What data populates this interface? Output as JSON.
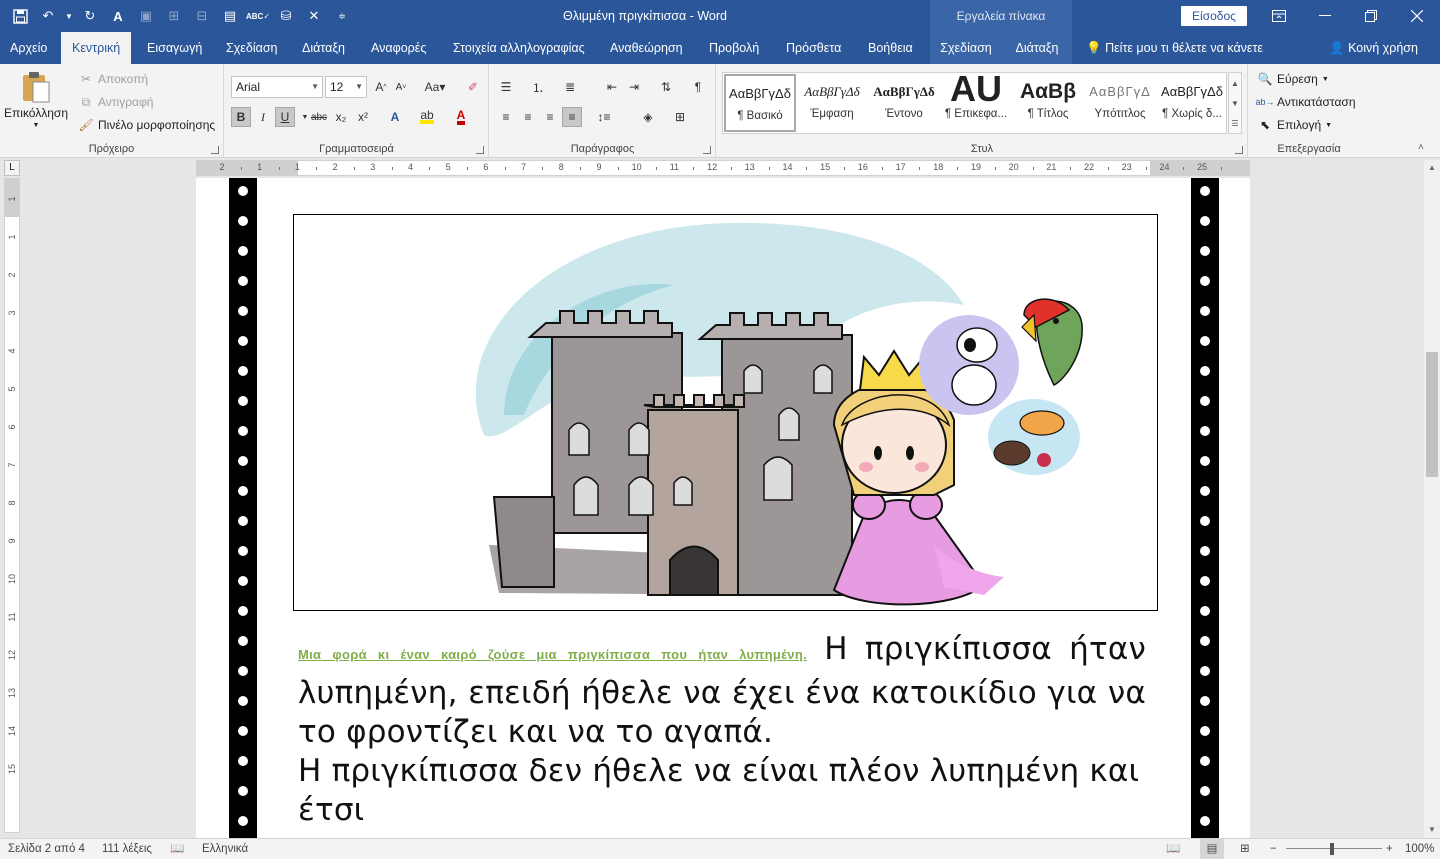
{
  "window": {
    "title": "Θλιμμένη πριγκίπισσα  -  Word",
    "context_tab": "Εργαλεία πίνακα",
    "signin": "Είσοδος"
  },
  "qat": [
    "save-icon",
    "undo-icon",
    "redo-icon",
    "font-icon",
    "checkbox-icon",
    "table-icon",
    "table-icon",
    "clipboard-icon",
    "spelling-icon",
    "thesaurus-icon",
    "close-icon",
    "more-icon"
  ],
  "tabs": [
    {
      "label": "Αρχείο"
    },
    {
      "label": "Κεντρική"
    },
    {
      "label": "Εισαγωγή"
    },
    {
      "label": "Σχεδίαση"
    },
    {
      "label": "Διάταξη"
    },
    {
      "label": "Αναφορές"
    },
    {
      "label": "Στοιχεία αλληλογραφίας"
    },
    {
      "label": "Αναθεώρηση"
    },
    {
      "label": "Προβολή"
    },
    {
      "label": "Πρόσθετα"
    },
    {
      "label": "Βοήθεια"
    },
    {
      "label": "Σχεδίαση"
    },
    {
      "label": "Διάταξη"
    }
  ],
  "tell_me": "Πείτε μου τι θέλετε να κάνετε",
  "share": "Κοινή χρήση",
  "clipboard": {
    "paste": "Επικόλληση",
    "cut": "Αποκοπή",
    "copy": "Αντιγραφή",
    "format_painter": "Πινέλο μορφοποίησης",
    "label": "Πρόχειρο"
  },
  "font": {
    "name": "Arial",
    "size": "12",
    "label": "Γραμματοσειρά",
    "bold": "B",
    "italic": "I",
    "underline": "U",
    "strike": "abc",
    "subscript": "x₂",
    "superscript": "x²",
    "grow": "A˄",
    "shrink": "A˅",
    "case": "Aa"
  },
  "paragraph": {
    "label": "Παράγραφος"
  },
  "styles": {
    "label": "Στυλ",
    "items": [
      {
        "preview": "ΑαΒβΓγΔδ",
        "name": "¶ Βασικό"
      },
      {
        "preview": "ΑαΒβΓγΔδ",
        "name": "Έμφαση"
      },
      {
        "preview": "ΑαΒβΓγΔδ",
        "name": "Έντονο"
      },
      {
        "preview": "AU",
        "name": "¶ Επικεφα..."
      },
      {
        "preview": "ΑαΒβ",
        "name": "¶ Τίτλος"
      },
      {
        "preview": "ΑαΒβΓγΔ",
        "name": "Υπότιτλος"
      },
      {
        "preview": "ΑαΒβΓγΔδ",
        "name": "¶ Χωρίς δ..."
      }
    ]
  },
  "editing": {
    "find": "Εύρεση",
    "replace": "Αντικατάσταση",
    "select": "Επιλογή",
    "label": "Επεξεργασία"
  },
  "ruler": {
    "h_numbers": [
      "2",
      "1",
      "1",
      "2",
      "3",
      "4",
      "5",
      "6",
      "7",
      "8",
      "9",
      "10",
      "11",
      "12",
      "13",
      "14",
      "15",
      "16",
      "17",
      "18",
      "19",
      "20",
      "21",
      "22",
      "23",
      "24",
      "25"
    ],
    "v_numbers": [
      "1",
      "1",
      "2",
      "3",
      "4",
      "5",
      "6",
      "7",
      "8",
      "9",
      "10",
      "11",
      "12",
      "13",
      "14",
      "15"
    ]
  },
  "document": {
    "lead": "Μια φορά κι έναν καιρό ζούσε μια πριγκίπισσα που ήταν λυπημένη.",
    "p1_rest": "Η πριγκίπισσα ήταν λυπημένη, επειδή ήθελε να έχει ένα κατοικίδιο για να το φροντίζει και να το αγαπά.",
    "p2": "Η πριγκίπισσα δεν ήθελε να είναι πλέον λυπημένη και έτσι",
    "colors": {
      "lead": "#7fae4a",
      "filmstrip": "#000000"
    }
  },
  "status": {
    "page": "Σελίδα 2 από 4",
    "words": "111 λέξεις",
    "language": "Ελληνικά",
    "zoom": "100%"
  },
  "theme": {
    "accent": "#2b579a"
  }
}
